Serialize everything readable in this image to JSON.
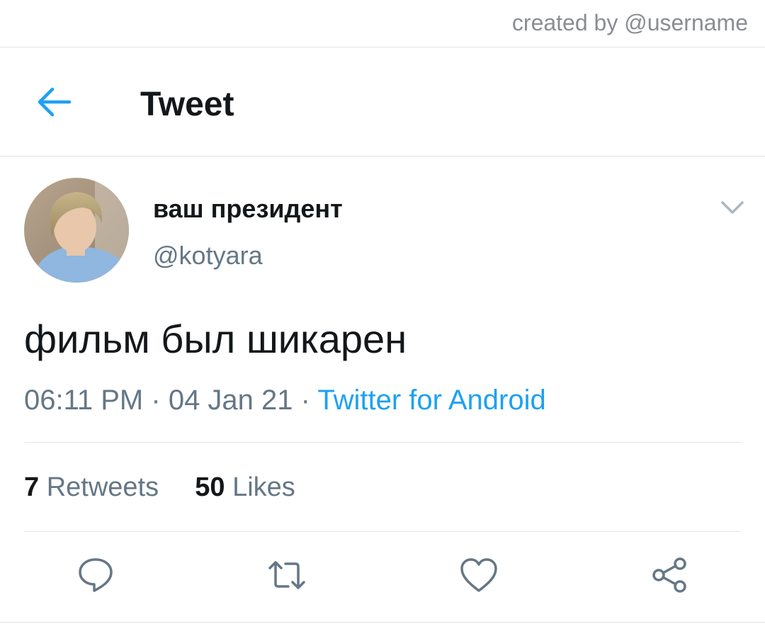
{
  "watermark": "created by @username",
  "header": {
    "title": "Tweet",
    "back_icon": "arrow-left-icon"
  },
  "tweet": {
    "display_name": "ваш президент",
    "handle": "@kotyara",
    "text": "фильм был шикарен",
    "time": "06:11 PM",
    "date": "04 Jan 21",
    "separator": "·",
    "source": "Twitter for Android",
    "retweets_count": "7",
    "retweets_label": "Retweets",
    "likes_count": "50",
    "likes_label": "Likes"
  },
  "actions": [
    {
      "name": "reply",
      "icon": "comment-icon"
    },
    {
      "name": "retweet",
      "icon": "retweet-icon"
    },
    {
      "name": "like",
      "icon": "heart-icon"
    },
    {
      "name": "share",
      "icon": "share-icon"
    }
  ],
  "colors": {
    "accent": "#1da1f2",
    "text_primary": "#14171a",
    "text_secondary": "#657786",
    "divider": "#e1e4e8",
    "icon_gray": "#657786"
  }
}
